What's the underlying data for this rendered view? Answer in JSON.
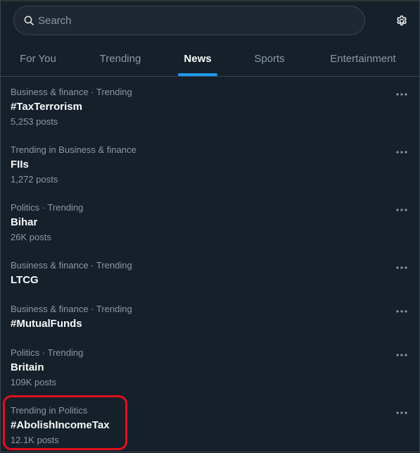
{
  "search": {
    "placeholder": "Search"
  },
  "tabs": [
    {
      "label": "For You",
      "active": false
    },
    {
      "label": "Trending",
      "active": false
    },
    {
      "label": "News",
      "active": true
    },
    {
      "label": "Sports",
      "active": false
    },
    {
      "label": "Entertainment",
      "active": false
    }
  ],
  "trends": [
    {
      "context": "Business & finance · Trending",
      "title": "#TaxTerrorism",
      "count": "5,253 posts"
    },
    {
      "context": "Trending in Business & finance",
      "title": "FIIs",
      "count": "1,272 posts"
    },
    {
      "context": "Politics · Trending",
      "title": "Bihar",
      "count": "26K posts"
    },
    {
      "context": "Business & finance · Trending",
      "title": "LTCG",
      "count": ""
    },
    {
      "context": "Business & finance · Trending",
      "title": "#MutualFunds",
      "count": ""
    },
    {
      "context": "Politics · Trending",
      "title": "Britain",
      "count": "109K posts"
    },
    {
      "context": "Trending in Politics",
      "title": "#AbolishIncomeTax",
      "count": "12.1K posts"
    }
  ],
  "colors": {
    "background": "#15202b",
    "accent": "#1d9bf0",
    "muted_text": "#8b98a5",
    "highlight": "#e0101f"
  },
  "icons": {
    "search": "search-icon",
    "settings": "gear-icon",
    "more": "more-dots-icon"
  }
}
